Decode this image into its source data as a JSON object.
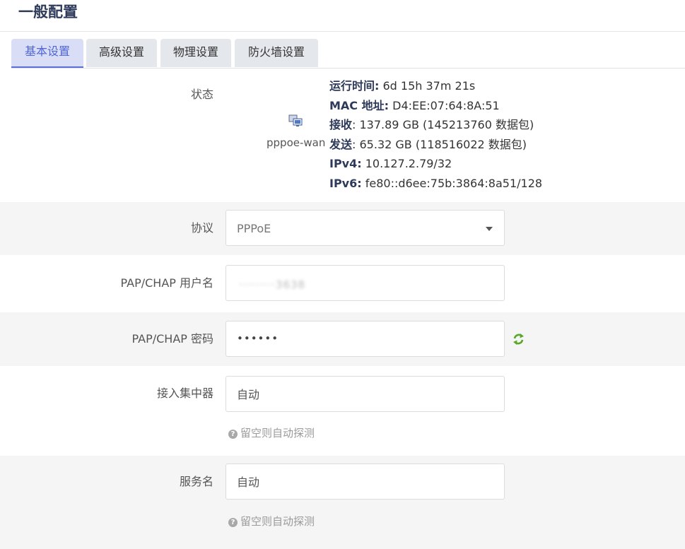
{
  "page": {
    "title": "一般配置"
  },
  "tabs": [
    {
      "label": "基本设置",
      "active": true
    },
    {
      "label": "高级设置",
      "active": false
    },
    {
      "label": "物理设置",
      "active": false
    },
    {
      "label": "防火墙设置",
      "active": false
    }
  ],
  "status": {
    "label": "状态",
    "interface_icon": "network-interface-icon",
    "interface_name": "pppoe-wan",
    "uptime_key": "运行时间:",
    "uptime_value": " 6d 15h 37m 21s",
    "mac_key": "MAC 地址:",
    "mac_value": " D4:EE:07:64:8A:51",
    "rx_key": "接收",
    "rx_value": ": 137.89 GB (145213760 数据包)",
    "tx_key": "发送",
    "tx_value": ": 65.32 GB (118516022 数据包)",
    "ipv4_key": "IPv4:",
    "ipv4_value": " 10.127.2.79/32",
    "ipv6_key": "IPv6:",
    "ipv6_value": " fe80::d6ee:75b:3864:8a51/128"
  },
  "protocol": {
    "label": "协议",
    "value": "PPPoE"
  },
  "username": {
    "label": "PAP/CHAP 用户名",
    "value": "·········3638"
  },
  "password": {
    "label": "PAP/CHAP 密码",
    "value": "••••••",
    "reveal_icon": "refresh-icon"
  },
  "access_concentrator": {
    "label": "接入集中器",
    "placeholder": "自动",
    "hint": "留空则自动探测"
  },
  "service_name": {
    "label": "服务名",
    "placeholder": "自动",
    "hint": "留空则自动探测"
  },
  "colors": {
    "accent": "#5b6fd9",
    "title": "#2e3a59",
    "refresh_green": "#5aa82a"
  }
}
